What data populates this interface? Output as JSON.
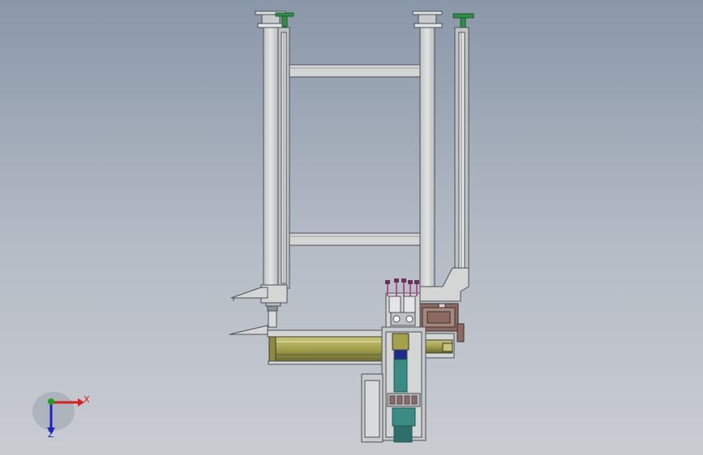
{
  "triad": {
    "x_label": "X",
    "z_label": "Z",
    "x_color": "#d42020",
    "y_color": "#1fa01f",
    "z_color": "#2020c8"
  },
  "palette": {
    "frame_fill": "#d4d5d5",
    "frame_stroke": "#4b4f55",
    "rail_fill": "#c0c3c5",
    "slot_fill": "#e8eae8",
    "actuator_olive": "#a4a14c",
    "actuator_dark": "#6b6a33",
    "foot_green": "#2f8f48",
    "motor_brown": "#8c6a63",
    "teal": "#3a8b83",
    "navy": "#1d2a8a",
    "pink_cable": "#b0508f"
  }
}
